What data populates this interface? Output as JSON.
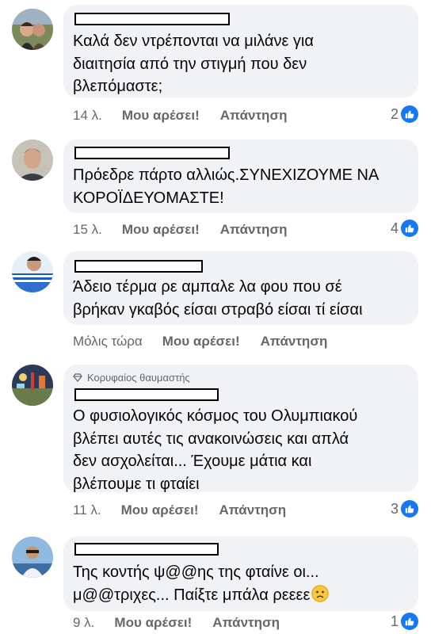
{
  "accent_color": "#1877f2",
  "comments": [
    {
      "text": "Καλά δεν ντρέπονται να μιλάνε για\nδιαιτησία από την στιγμή που δεν\nβλεπόμαστε;",
      "time": "14 λ.",
      "like_label": "Μου αρέσει!",
      "reply_label": "Απάντηση",
      "reactions": "2",
      "reaction_icon": "thumbs-up-icon"
    },
    {
      "text": "Πρόεδρε πάρτο αλλιώς.ΣΥΝΕΧΙΖΟΥΜΕ ΝΑ\nΚΟΡΟΪΔΕΥΟΜΑΣΤΕ!",
      "time": "15 λ.",
      "like_label": "Μου αρέσει!",
      "reply_label": "Απάντηση",
      "reactions": "4",
      "reaction_icon": "thumbs-up-icon"
    },
    {
      "text": "Άδειο τέρμα ρε αμπαλε λα φου που σέ\nβρήκαν γκαβός είσαι στραβό είσαι τί είσαι",
      "time": "Μόλις τώρα",
      "like_label": "Μου αρέσει!",
      "reply_label": "Απάντηση",
      "reaction_icon": ""
    },
    {
      "badge": "Κορυφαίος θαυμαστής",
      "badge_icon": "diamond-icon",
      "text": "Ο φυσιολογικός κόσμος του Ολυμπιακού\nβλέπει αυτές τις ανακοινώσεις και απλά\nδεν ασχολείται... Έχουμε μάτια και\nβλέπουμε τι φταίει",
      "time": "11 λ.",
      "like_label": "Μου αρέσει!",
      "reply_label": "Απάντηση",
      "reactions": "3",
      "reaction_icon": "thumbs-up-icon"
    },
    {
      "text": "Της κοντής ψ@@ης της φταίνε οι...\nμ@@τριχες... Παίξτε μπάλα ρεεεε",
      "emoji": "slightly-frowning-face-emoji",
      "time": "9 λ.",
      "like_label": "Μου αρέσει!",
      "reply_label": "Απάντηση",
      "reactions": "1",
      "reaction_icon": "thumbs-up-icon"
    }
  ]
}
